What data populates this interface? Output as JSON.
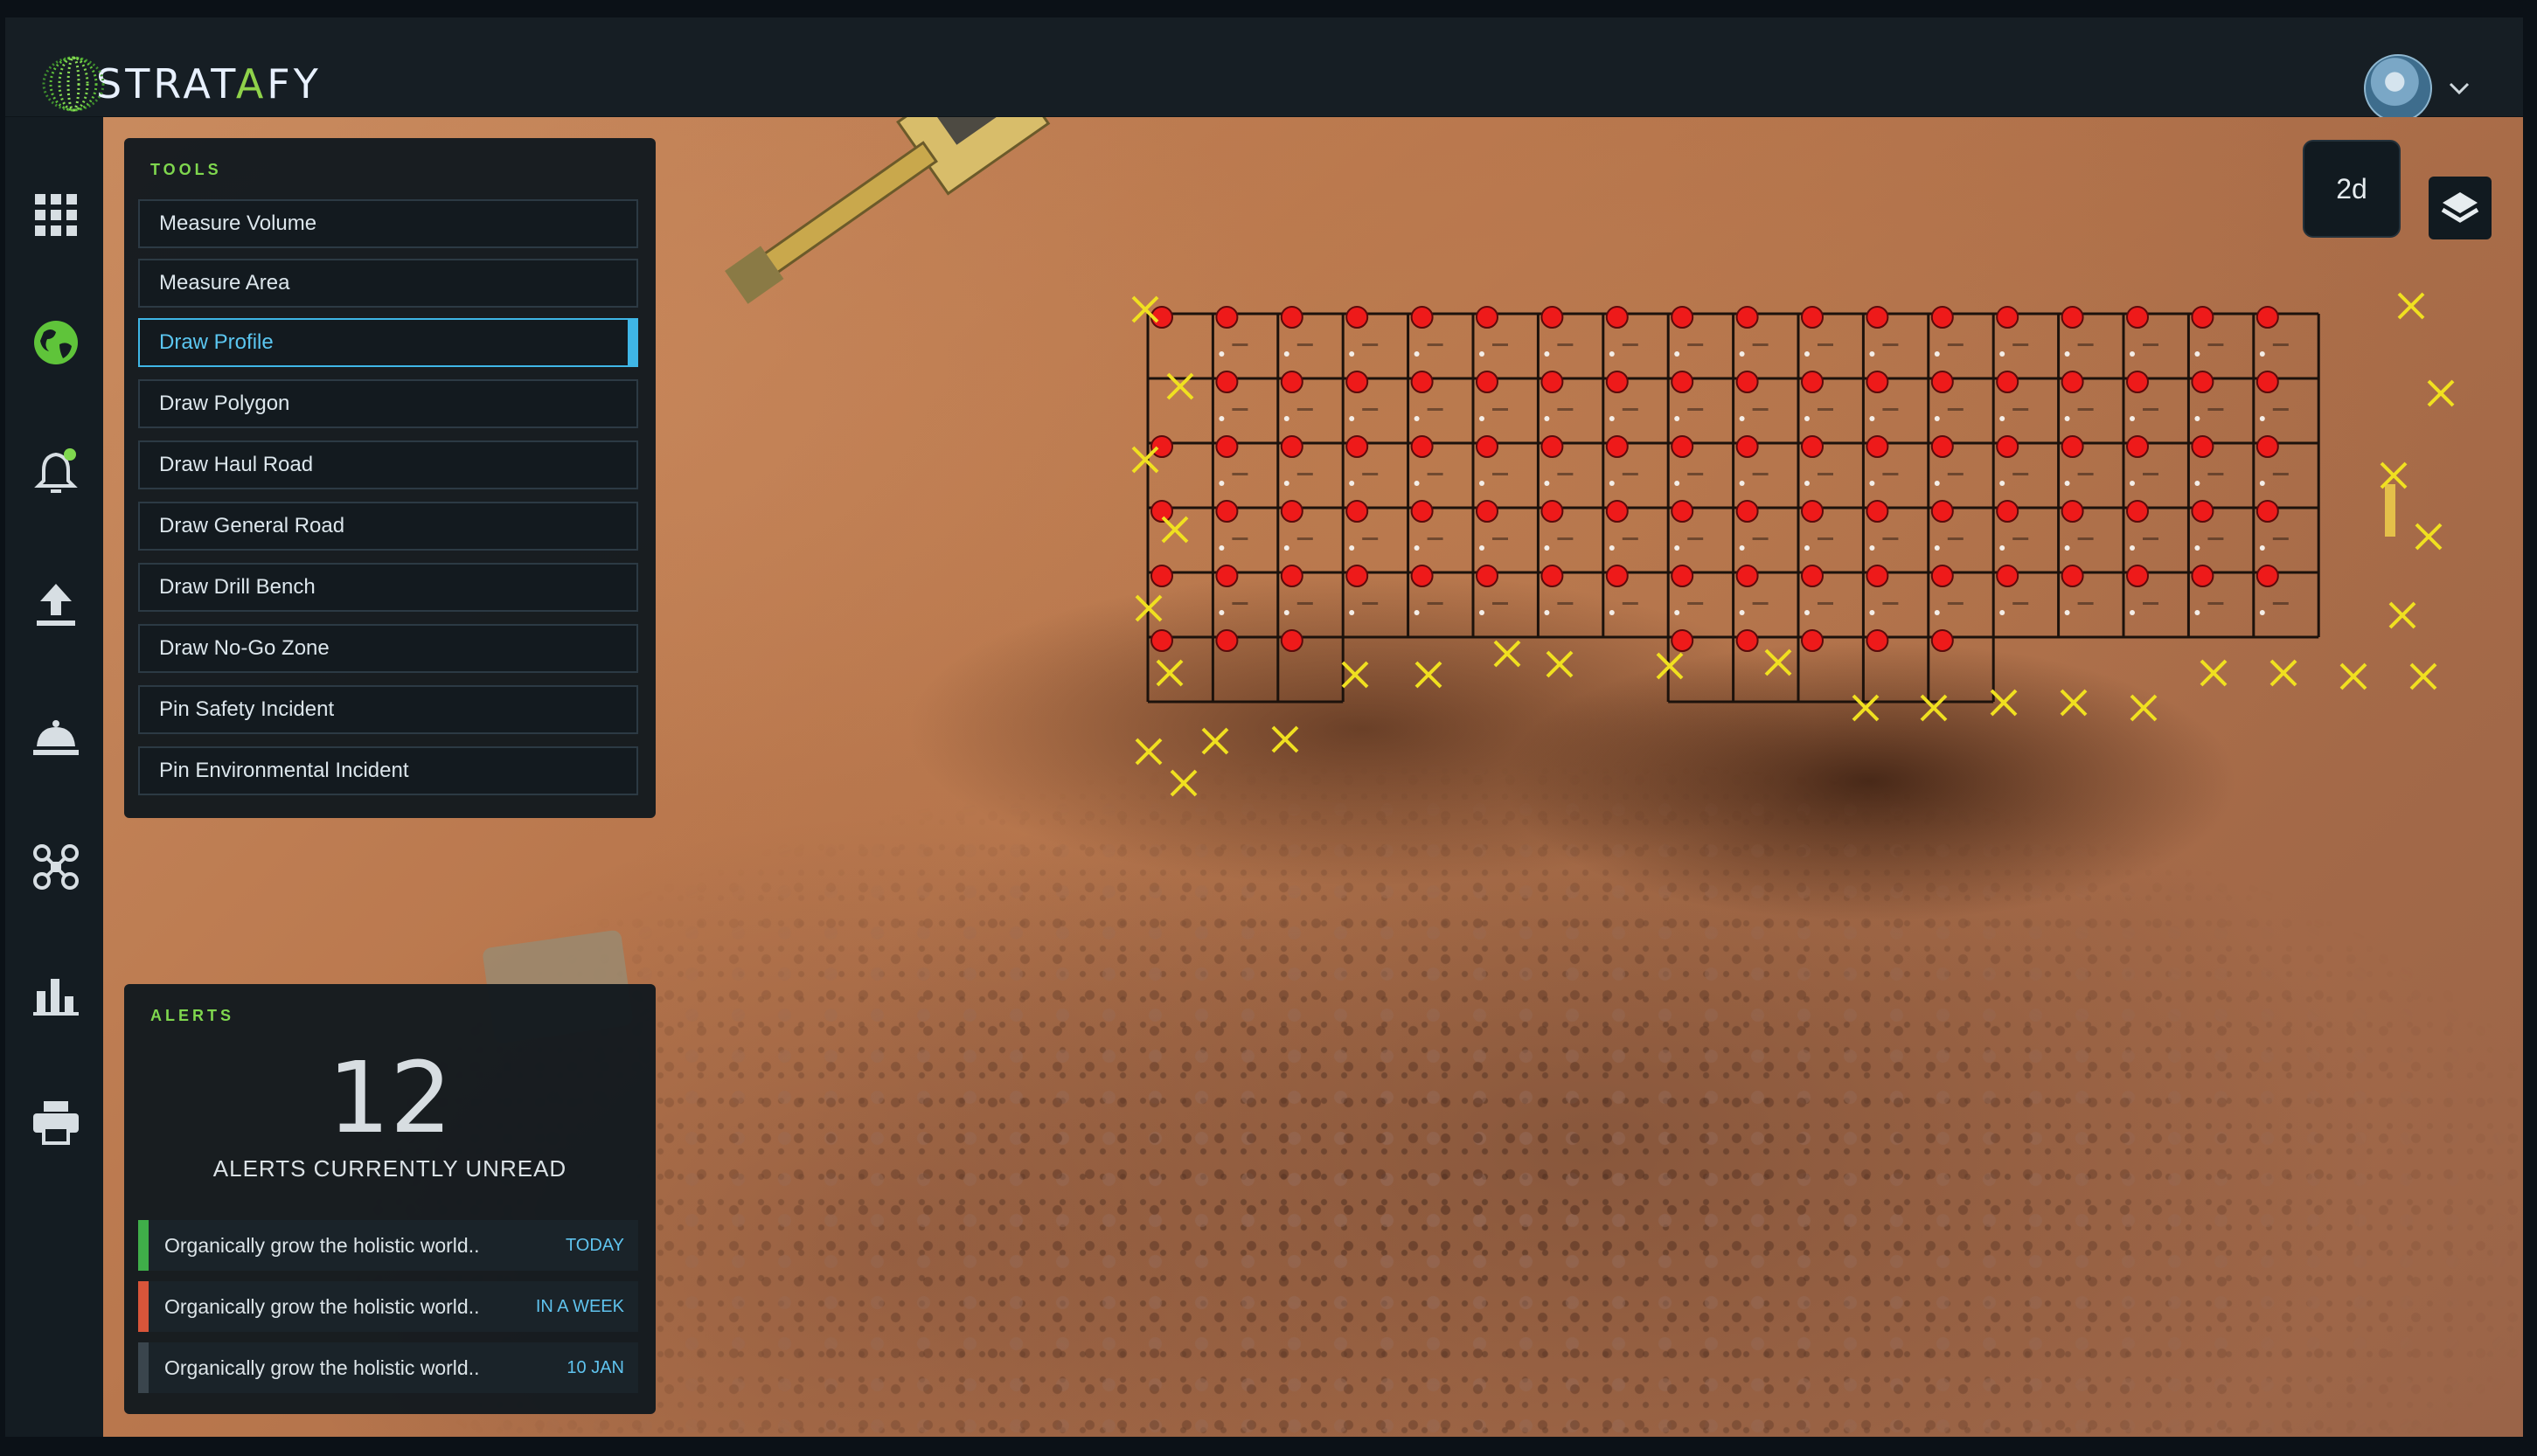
{
  "app": {
    "brand": "STRATAFY",
    "accent": "#7fd74e",
    "highlight": "#3fb6e6"
  },
  "header": {
    "user_menu_icon": "chevron-down-icon",
    "avatar": "user-avatar"
  },
  "sidebar": {
    "items": [
      {
        "icon": "grid-apps-icon",
        "active": false
      },
      {
        "icon": "globe-icon",
        "active": true
      },
      {
        "icon": "bell-notification-icon",
        "active": false
      },
      {
        "icon": "upload-icon",
        "active": false
      },
      {
        "icon": "dome-bell-icon",
        "active": false
      },
      {
        "icon": "drone-icon",
        "active": false
      },
      {
        "icon": "bar-chart-icon",
        "active": false
      },
      {
        "icon": "printer-icon",
        "active": false
      }
    ]
  },
  "tools": {
    "title": "TOOLS",
    "items": [
      {
        "label": "Measure Volume"
      },
      {
        "label": "Measure Area"
      },
      {
        "label": "Draw Profile",
        "active": true
      },
      {
        "label": "Draw Polygon"
      },
      {
        "label": "Draw Haul Road"
      },
      {
        "label": "Draw General Road"
      },
      {
        "label": "Draw Drill Bench"
      },
      {
        "label": "Draw No-Go Zone"
      },
      {
        "label": "Pin Safety Incident"
      },
      {
        "label": "Pin Environmental Incident"
      }
    ]
  },
  "alerts": {
    "title": "ALERTS",
    "count": "12",
    "subtitle": "ALERTS CURRENTLY UNREAD",
    "items": [
      {
        "text": "Organically grow the holistic world..",
        "when": "TODAY",
        "color": "#3fae49"
      },
      {
        "text": "Organically grow the holistic world..",
        "when": "IN A WEEK",
        "color": "#d8553a"
      },
      {
        "text": "Organically grow the holistic world..",
        "when": "10 JAN",
        "color": "#3a454d"
      }
    ]
  },
  "map": {
    "view_mode": "2d",
    "layers_icon": "layers-icon",
    "drill_hole_color": "#ee1a1a",
    "marker_color": "#f0e020"
  }
}
